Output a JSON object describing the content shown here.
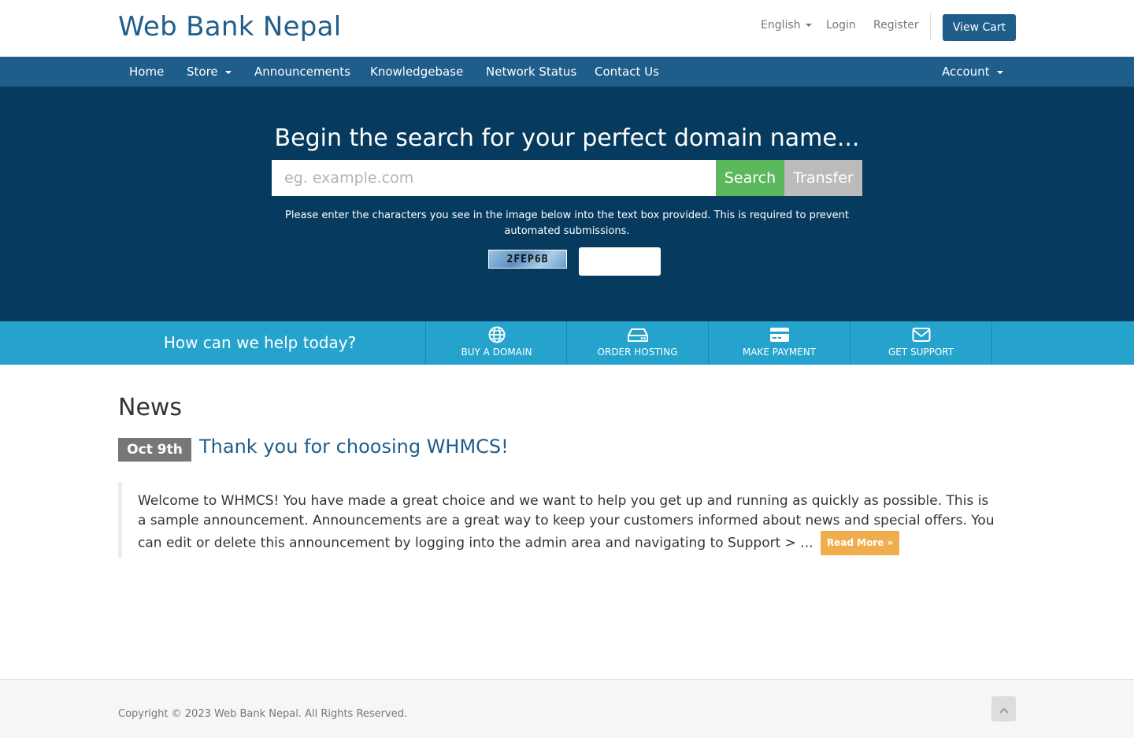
{
  "header": {
    "logo": "Web Bank Nepal",
    "language": "English",
    "login": "Login",
    "register": "Register",
    "view_cart": "View Cart"
  },
  "nav": {
    "items": [
      {
        "label": "Home"
      },
      {
        "label": "Store",
        "dropdown": true
      },
      {
        "label": "Announcements"
      },
      {
        "label": "Knowledgebase"
      },
      {
        "label": "Network Status"
      },
      {
        "label": "Contact Us"
      }
    ],
    "account": "Account"
  },
  "hero": {
    "title": "Begin the search for your perfect domain name...",
    "placeholder": "eg. example.com",
    "search_label": "Search",
    "transfer_label": "Transfer",
    "captcha_note": "Please enter the characters you see in the image below into the text box provided. This is required to prevent automated submissions.",
    "captcha_code": "2FEP6B"
  },
  "help": {
    "question": "How can we help today?",
    "items": [
      {
        "label": "BUY A DOMAIN",
        "icon": "globe-icon"
      },
      {
        "label": "ORDER HOSTING",
        "icon": "hard-drive-icon"
      },
      {
        "label": "MAKE PAYMENT",
        "icon": "credit-card-icon"
      },
      {
        "label": "GET SUPPORT",
        "icon": "envelope-icon"
      }
    ]
  },
  "news": {
    "heading": "News",
    "items": [
      {
        "date": "Oct 9th",
        "title": "Thank you for choosing WHMCS!",
        "excerpt": "Welcome to WHMCS! You have made a great choice and we want to help you get up and running as quickly as possible. This is a sample announcement. Announcements are a great way to keep your customers informed about news and special offers. You can edit or delete this announcement by logging into the admin area and navigating to Support > ...",
        "read_more": "Read More »"
      }
    ]
  },
  "footer": {
    "copyright": "Copyright © 2023 Web Bank Nepal. All Rights Reserved."
  },
  "colors": {
    "brand": "#1f5d8a",
    "hero_bg": "#063a5e",
    "help_bar": "#25a3cc",
    "search_button": "#5cb85c",
    "read_more": "#f0ad4e"
  }
}
